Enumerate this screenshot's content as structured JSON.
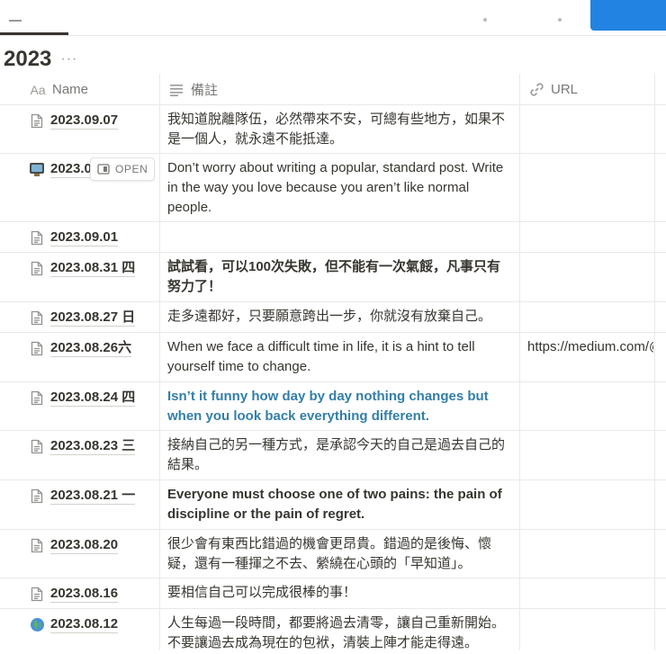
{
  "database": {
    "title": "2023",
    "more_label": "···"
  },
  "columns": {
    "name": {
      "icon": "text-type-icon",
      "label": "Name",
      "prefix": "Aa"
    },
    "note": {
      "icon": "lines-icon",
      "label": "備註"
    },
    "url": {
      "icon": "link-icon",
      "label": "URL"
    }
  },
  "open_button": {
    "label": "OPEN",
    "icon": "open-panel-icon"
  },
  "rows": [
    {
      "icon": "page-icon",
      "name": "2023.09.07",
      "note": "我知道脫離隊伍，必然帶來不安，可總有些地方，如果不是一個人，就永遠不能抵達。",
      "url": ""
    },
    {
      "icon": "tv-icon",
      "name": "2023.09.05",
      "note": "Don’t worry about writing a popular, standard post. Write in the way you love because you aren’t like normal people.",
      "url": ""
    },
    {
      "icon": "page-icon",
      "name": "2023.09.01",
      "note": "",
      "url": ""
    },
    {
      "icon": "page-icon",
      "name": "2023.08.31 四",
      "note": "試試看，可以100次失敗，但不能有一次氣餒，凡事只有努力了！",
      "url": ""
    },
    {
      "icon": "page-icon",
      "name": "2023.08.27 日",
      "note": "走多遠都好，只要願意跨出一步，你就沒有放棄自己。",
      "url": ""
    },
    {
      "icon": "page-icon",
      "name": "2023.08.26六",
      "note": "When we face a difficult time in life, it is a hint to tell yourself time to change.",
      "url": "https://medium.com/@"
    },
    {
      "icon": "page-icon",
      "name": "2023.08.24 四",
      "note": "Isn’t it funny how day by day nothing changes but when you look back everything different.",
      "url": ""
    },
    {
      "icon": "page-icon",
      "name": "2023.08.23 三",
      "note": "接納自己的另一種方式，是承認今天的自己是過去自己的結果。",
      "url": ""
    },
    {
      "icon": "page-icon",
      "name": "2023.08.21 一",
      "note": "Everyone must choose one of two pains: the pain of discipline or the pain of regret.",
      "url": ""
    },
    {
      "icon": "page-icon",
      "name": "2023.08.20",
      "note": "很少會有東西比錯過的機會更昂貴。錯過的是後悔、懷疑，還有一種揮之不去、縈繞在心頭的「早知道」。",
      "url": ""
    },
    {
      "icon": "page-icon",
      "name": "2023.08.16",
      "note": "要相信自己可以完成很棒的事！",
      "url": ""
    },
    {
      "icon": "globe-icon",
      "name": "2023.08.12",
      "note": "人生每過一段時間，都要將過去清零，讓自己重新開始。不要讓過去成為現在的包袱，清裝上陣才能走得遠。",
      "url": ""
    }
  ],
  "colors": {
    "text": "#37352f",
    "muted": "#787774",
    "border": "#e9e9e7",
    "accent_blue": "#2383e2",
    "highlight_text_blue": "#337ea9"
  }
}
